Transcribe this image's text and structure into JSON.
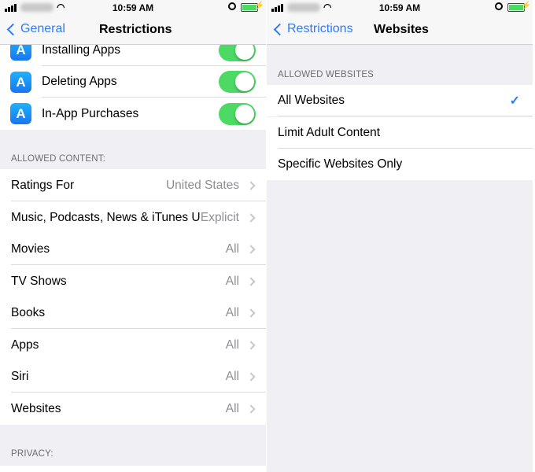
{
  "status_bar": {
    "time": "10:59 AM"
  },
  "left": {
    "back_label": "General",
    "title": "Restrictions",
    "toggles": [
      {
        "label": "Installing Apps",
        "on": true
      },
      {
        "label": "Deleting Apps",
        "on": true
      },
      {
        "label": "In-App Purchases",
        "on": true
      }
    ],
    "allowed_content_header": "ALLOWED CONTENT:",
    "content_rows": [
      {
        "label": "Ratings For",
        "value": "United States"
      },
      {
        "label": "Music, Podcasts, News & iTunes U",
        "value": "Explicit"
      },
      {
        "label": "Movies",
        "value": "All"
      },
      {
        "label": "TV Shows",
        "value": "All"
      },
      {
        "label": "Books",
        "value": "All"
      },
      {
        "label": "Apps",
        "value": "All"
      },
      {
        "label": "Siri",
        "value": "All"
      },
      {
        "label": "Websites",
        "value": "All"
      }
    ],
    "privacy_header": "PRIVACY:"
  },
  "right": {
    "back_label": "Restrictions",
    "title": "Websites",
    "header": "ALLOWED WEBSITES",
    "options": [
      {
        "label": "All Websites",
        "selected": true
      },
      {
        "label": "Limit Adult Content",
        "selected": false
      },
      {
        "label": "Specific Websites Only",
        "selected": false
      }
    ]
  },
  "colors": {
    "accent": "#2f7cf6",
    "toggle_on": "#4cd964"
  }
}
